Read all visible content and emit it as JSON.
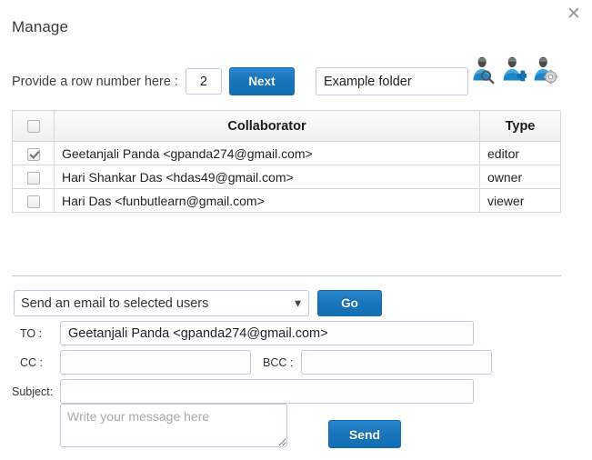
{
  "dialog": {
    "title": "Manage",
    "close_label": "✕",
    "close_icon": "close-icon"
  },
  "rownum": {
    "label": "Provide a row number here :",
    "value": "2",
    "placeholder": "",
    "next_label": "Next",
    "folder_value": "Example folder",
    "folder_placeholder": ""
  },
  "icons": [
    {
      "name": "user-search-icon",
      "title": "Search user"
    },
    {
      "name": "user-add-icon",
      "title": "Add user"
    },
    {
      "name": "user-settings-icon",
      "title": "User settings"
    }
  ],
  "table": {
    "headers": [
      "",
      "Collaborator",
      "Type"
    ],
    "header_checkbox_checked": false,
    "rows": [
      {
        "checked": true,
        "collaborator": "Geetanjali Panda <gpanda274@gmail.com>",
        "type": "editor"
      },
      {
        "checked": false,
        "collaborator": "Hari Shankar Das <hdas49@gmail.com>",
        "type": "owner"
      },
      {
        "checked": false,
        "collaborator": "Hari Das <funbutlearn@gmail.com>",
        "type": "viewer"
      }
    ]
  },
  "email": {
    "action_selected": "Send an email to selected users",
    "action_caret": "▼",
    "go_label": "Go",
    "to_label": "TO :",
    "to_value": "Geetanjali Panda <gpanda274@gmail.com>",
    "to_placeholder": "",
    "cc_label": "CC :",
    "cc_value": "",
    "cc_placeholder": "",
    "bcc_label": "BCC :",
    "bcc_value": "",
    "bcc_placeholder": "",
    "subject_label": "Subject:",
    "subject_value": "",
    "subject_placeholder": "",
    "message_value": "",
    "message_placeholder": "Write your message here",
    "send_label": "Send"
  },
  "colors": {
    "button_blue": "#1775bb",
    "button_blue_border": "#1668a8",
    "input_border": "#c7c3e0",
    "divider": "#c6c6c6",
    "table_border": "#d8d8d8",
    "icon_blue": "#2f9bd6"
  }
}
